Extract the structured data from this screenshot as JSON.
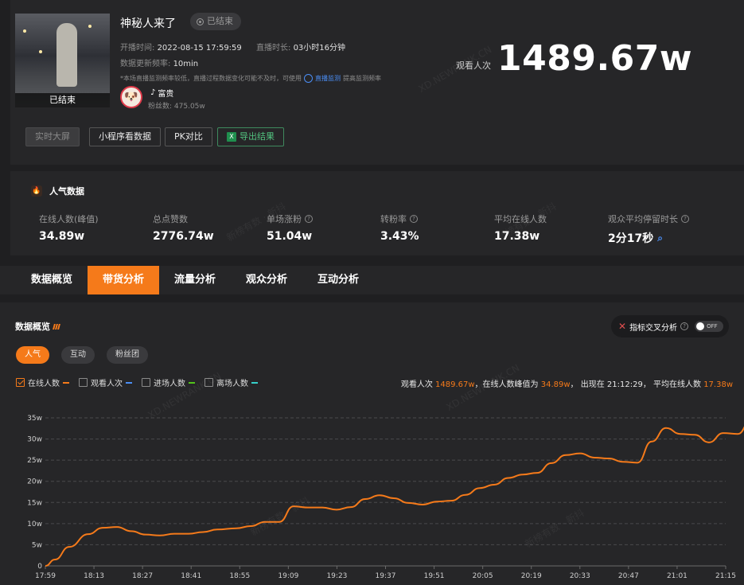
{
  "header": {
    "thumb_caption": "已结束",
    "title": "神秘人来了",
    "status_badge": "已结束",
    "start_label": "开播时间:",
    "start_value": "2022-08-15 17:59:59",
    "duration_label": "直播时长:",
    "duration_value": "03小时16分钟",
    "refresh_label": "数据更新频率:",
    "refresh_value": "10min",
    "note": "*本场直播监测频率较低，直播过程数据变化可能不及时，可使用",
    "note_link": "直播监测",
    "note_tail": "提高监测频率",
    "owner_name": "富贵",
    "fans_label": "粉丝数:",
    "fans_value": "475.05w",
    "views_label": "观看人次",
    "views_value": "1489.67w"
  },
  "actions": {
    "realtime": "实时大屏",
    "miniprogram": "小程序看数据",
    "pk": "PK对比",
    "export": "导出结果"
  },
  "popularity": {
    "title": "人气数据",
    "stats": [
      {
        "label": "在线人数(峰值)",
        "value": "34.89w"
      },
      {
        "label": "总点赞数",
        "value": "2776.74w"
      },
      {
        "label": "单场涨粉",
        "value": "51.04w"
      },
      {
        "label": "转粉率",
        "value": "3.43%"
      },
      {
        "label": "平均在线人数",
        "value": "17.38w"
      },
      {
        "label": "观众平均停留时长",
        "value": "2分17秒"
      }
    ]
  },
  "tabs": [
    "数据概览",
    "带货分析",
    "流量分析",
    "观众分析",
    "互动分析"
  ],
  "overview": {
    "title": "数据概览",
    "cross_label": "指标交叉分析",
    "toggle_label": "OFF",
    "pills": [
      "人气",
      "互动",
      "粉丝团"
    ],
    "legend": [
      {
        "name": "在线人数",
        "color": "#f57a1a",
        "checked": true
      },
      {
        "name": "观看人次",
        "color": "#4b8ef5",
        "checked": false
      },
      {
        "name": "进场人数",
        "color": "#52c41a",
        "checked": false
      },
      {
        "name": "离场人数",
        "color": "#36cfc9",
        "checked": false
      }
    ],
    "summary": {
      "p1": "观看人次 ",
      "views": "1489.67w",
      "p2": "，在线人数峰值为 ",
      "peak": "34.89w",
      "p3": "， 出现在 21:12:29， 平均在线人数 ",
      "avg": "17.38w"
    }
  },
  "watermark": {
    "texts": [
      "XD.NEWRANK.CN",
      "新榜有数 · 新抖"
    ]
  },
  "chart_data": {
    "type": "line",
    "series": [
      {
        "name": "在线人数",
        "color": "#f57a1a"
      }
    ],
    "y_ticks": [
      "0",
      "5w",
      "10w",
      "15w",
      "20w",
      "25w",
      "30w",
      "35w"
    ],
    "ylim": [
      0,
      35
    ],
    "x_ticks": [
      "17:59",
      "18:13",
      "18:27",
      "18:41",
      "18:55",
      "19:09",
      "19:23",
      "19:37",
      "19:51",
      "20:05",
      "20:19",
      "20:33",
      "20:47",
      "21:01",
      "21:15"
    ],
    "points": [
      [
        0,
        0
      ],
      [
        0.2,
        1.5
      ],
      [
        0.5,
        4.5
      ],
      [
        0.9,
        7.5
      ],
      [
        1.2,
        9.0
      ],
      [
        1.5,
        9.2
      ],
      [
        1.8,
        8.2
      ],
      [
        2.1,
        7.4
      ],
      [
        2.4,
        7.2
      ],
      [
        2.7,
        7.6
      ],
      [
        3.0,
        7.6
      ],
      [
        3.3,
        8.0
      ],
      [
        3.6,
        8.6
      ],
      [
        4.0,
        8.9
      ],
      [
        4.3,
        9.4
      ],
      [
        4.6,
        10.4
      ],
      [
        4.9,
        10.4
      ],
      [
        5.2,
        14.1
      ],
      [
        5.5,
        13.8
      ],
      [
        5.8,
        13.8
      ],
      [
        6.1,
        13.3
      ],
      [
        6.4,
        13.9
      ],
      [
        6.7,
        15.8
      ],
      [
        7.0,
        16.7
      ],
      [
        7.3,
        16.0
      ],
      [
        7.6,
        14.9
      ],
      [
        7.9,
        14.5
      ],
      [
        8.2,
        15.2
      ],
      [
        8.5,
        15.4
      ],
      [
        8.8,
        16.8
      ],
      [
        9.1,
        18.4
      ],
      [
        9.4,
        19.2
      ],
      [
        9.7,
        20.8
      ],
      [
        10.0,
        21.6
      ],
      [
        10.3,
        22.0
      ],
      [
        10.6,
        24.3
      ],
      [
        10.9,
        26.2
      ],
      [
        11.2,
        26.6
      ],
      [
        11.5,
        25.6
      ],
      [
        11.8,
        25.4
      ],
      [
        12.1,
        24.6
      ],
      [
        12.4,
        24.4
      ],
      [
        12.7,
        29.4
      ],
      [
        13.0,
        32.6
      ],
      [
        13.3,
        31.2
      ],
      [
        13.6,
        31.0
      ],
      [
        13.9,
        29.2
      ],
      [
        14.2,
        31.4
      ],
      [
        14.5,
        31.2
      ],
      [
        14.8,
        34.8
      ],
      [
        15.1,
        34.9
      ],
      [
        15.2,
        34.9
      ]
    ]
  }
}
